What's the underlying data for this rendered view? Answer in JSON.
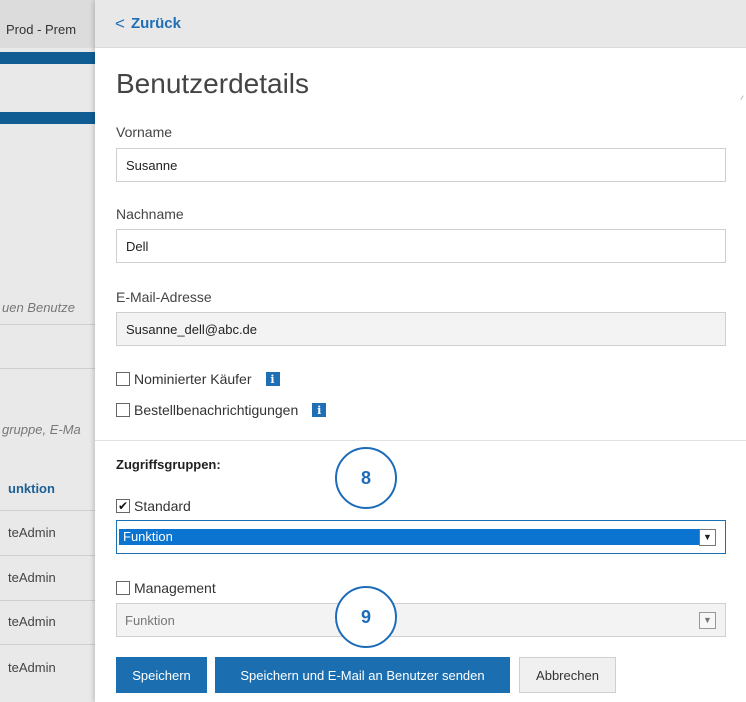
{
  "background": {
    "title": "Prod - Prem",
    "hint_new_user": "uen Benutze",
    "hint_search": "gruppe, E-Ma",
    "column_header": "unktion",
    "rows": [
      "teAdmin",
      "teAdmin",
      "teAdmin",
      "teAdmin"
    ]
  },
  "header": {
    "back_chevron": "<",
    "back_label": "Zurück"
  },
  "form": {
    "title": "Benutzerdetails",
    "first_name": {
      "label": "Vorname",
      "value": "Susanne"
    },
    "last_name": {
      "label": "Nachname",
      "value": "Dell"
    },
    "email": {
      "label": "E-Mail-Adresse",
      "value": "Susanne_dell@abc.de"
    },
    "nominated_buyer": {
      "label": "Nominierter Käufer",
      "checked": false
    },
    "order_notifications": {
      "label": "Bestellbenachrichtigungen",
      "checked": false
    },
    "info_icon": "i"
  },
  "access_groups": {
    "label": "Zugriffsgruppen:",
    "standard": {
      "label": "Standard",
      "checked": true,
      "check_glyph": "✔",
      "select_value": "Funktion"
    },
    "management": {
      "label": "Management",
      "checked": false,
      "select_value": "Funktion"
    },
    "arrow_glyph": "▼"
  },
  "callouts": {
    "eight": "8",
    "nine": "9"
  },
  "buttons": {
    "save": "Speichern",
    "save_and_email": "Speichern und E-Mail an Benutzer senden",
    "cancel": "Abbrechen"
  },
  "colors": {
    "accent": "#1b6fb1",
    "selected": "#0b74d1",
    "callout": "#1c6cb9"
  }
}
